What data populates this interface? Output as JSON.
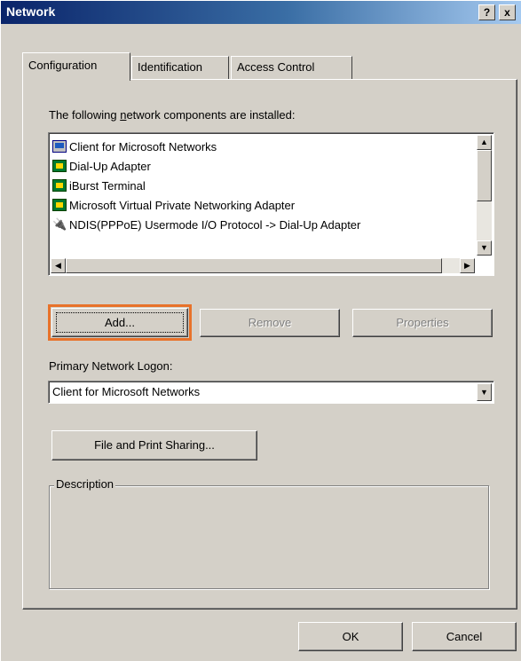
{
  "window": {
    "title": "Network",
    "help_btn": "?",
    "close_btn": "x"
  },
  "tabs": [
    {
      "label": "Configuration",
      "active": true
    },
    {
      "label": "Identification",
      "active": false
    },
    {
      "label": "Access Control",
      "active": false
    }
  ],
  "components": {
    "label_pre": "The following ",
    "label_access": "n",
    "label_post": "etwork components are installed:",
    "items": [
      {
        "label": "Client for Microsoft Networks",
        "icon": "computer-icon"
      },
      {
        "label": "Dial-Up Adapter",
        "icon": "network-adapter-icon"
      },
      {
        "label": "iBurst Terminal",
        "icon": "network-adapter-icon"
      },
      {
        "label": "Microsoft Virtual Private Networking Adapter",
        "icon": "network-adapter-icon"
      },
      {
        "label": "NDIS(PPPoE) Usermode I/O Protocol -> Dial-Up Adapter",
        "icon": "protocol-icon"
      }
    ]
  },
  "buttons": {
    "add": "Add...",
    "remove": "Remove",
    "properties": "Properties",
    "file_print": "File and Print Sharing...",
    "ok": "OK",
    "cancel": "Cancel"
  },
  "logon": {
    "label": "Primary Network Logon:",
    "value": "Client for Microsoft Networks"
  },
  "description": {
    "label": "Description",
    "text": ""
  },
  "colors": {
    "highlight": "#e8722a",
    "titlebar_start": "#0a246a",
    "face": "#d4d0c8"
  }
}
